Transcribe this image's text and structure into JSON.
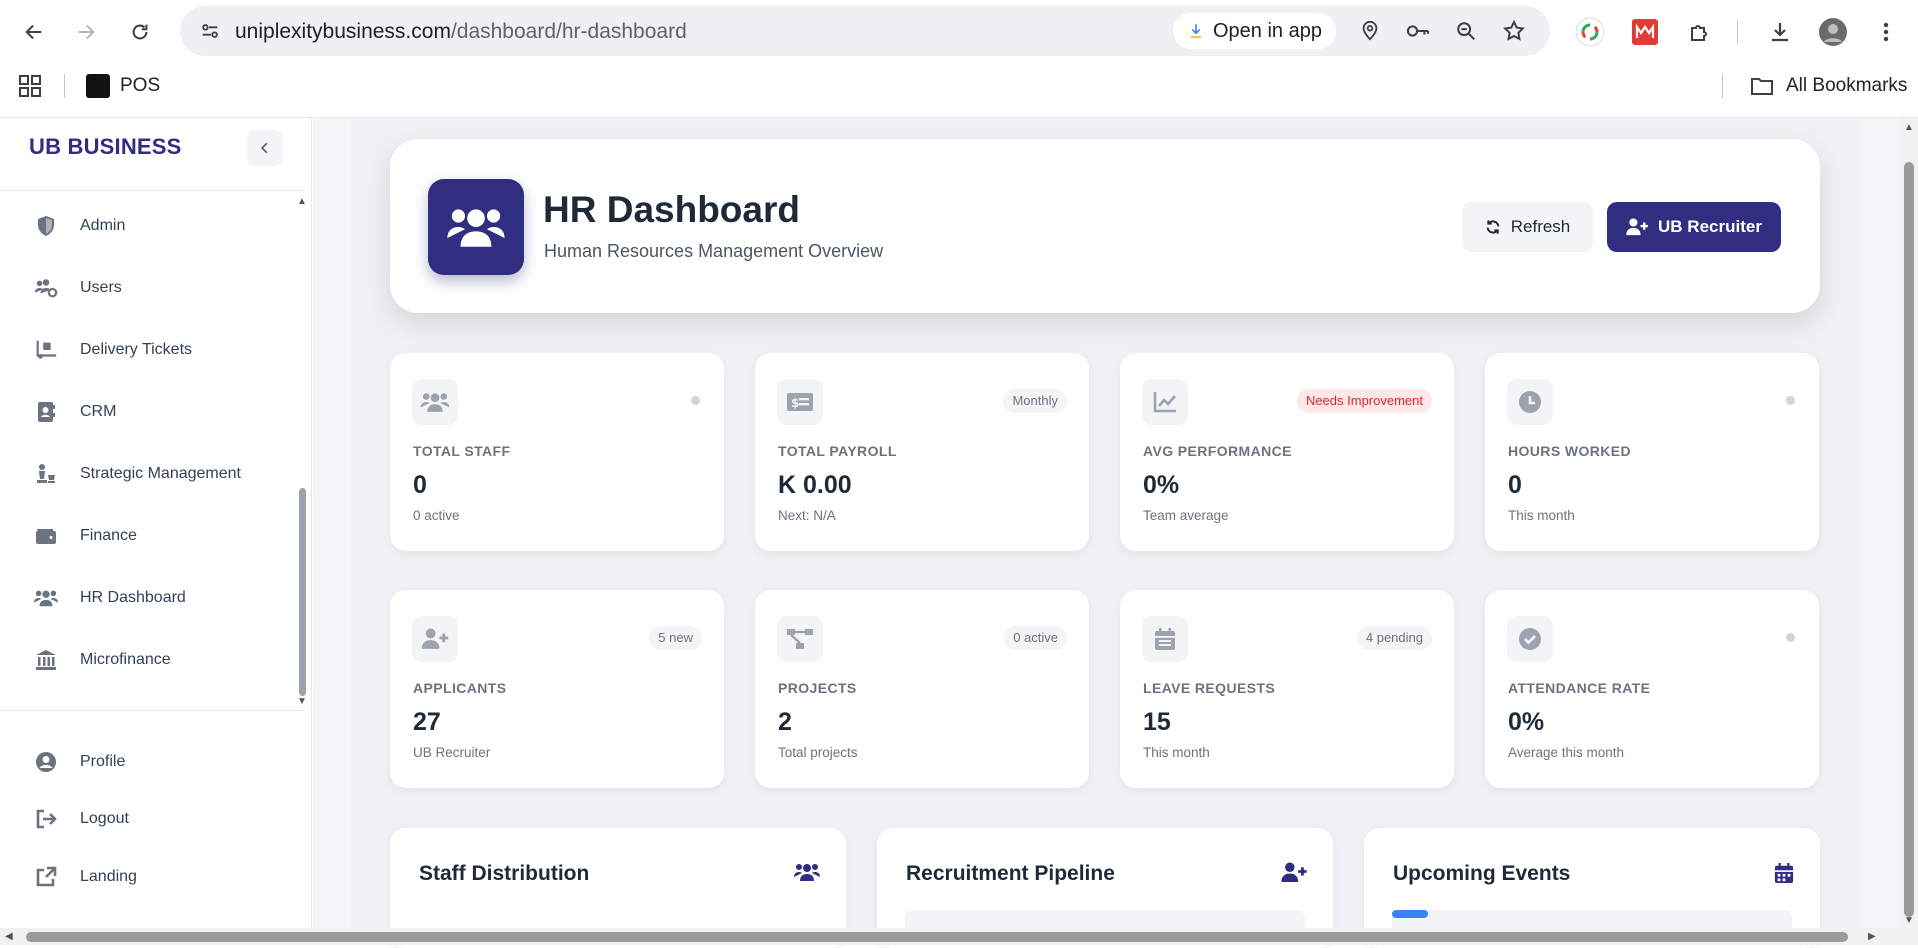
{
  "browser": {
    "url_host": "uniplexitybusiness.com",
    "url_path": "/dashboard/hr-dashboard",
    "open_in_app": "Open in app",
    "bookmarks": [
      {
        "label": "POS"
      }
    ],
    "all_bookmarks": "All Bookmarks"
  },
  "sidebar": {
    "brand": "UB BUSINESS",
    "items": [
      {
        "label": "Admin",
        "icon": "shield-icon"
      },
      {
        "label": "Users",
        "icon": "users-cog-icon"
      },
      {
        "label": "Delivery Tickets",
        "icon": "truck-loading-icon"
      },
      {
        "label": "CRM",
        "icon": "address-book-icon"
      },
      {
        "label": "Strategic Management",
        "icon": "chess-icon"
      },
      {
        "label": "Finance",
        "icon": "wallet-icon"
      },
      {
        "label": "HR Dashboard",
        "icon": "users-icon"
      },
      {
        "label": "Microfinance",
        "icon": "bank-icon"
      }
    ],
    "footer_items": [
      {
        "label": "Profile",
        "icon": "user-circle-icon"
      },
      {
        "label": "Logout",
        "icon": "logout-icon"
      },
      {
        "label": "Landing",
        "icon": "external-link-icon"
      }
    ]
  },
  "header": {
    "title": "HR Dashboard",
    "subtitle": "Human Resources Management Overview",
    "refresh_label": "Refresh",
    "recruiter_label": "UB Recruiter"
  },
  "stats": [
    {
      "label": "TOTAL STAFF",
      "value": "0",
      "sub": "0 active",
      "badge": "",
      "icon": "users-icon"
    },
    {
      "label": "TOTAL PAYROLL",
      "value": "K 0.00",
      "sub": "Next: N/A",
      "badge": "Monthly",
      "icon": "money-check-icon"
    },
    {
      "label": "AVG PERFORMANCE",
      "value": "0%",
      "sub": "Team average",
      "badge": "Needs Improvement",
      "icon": "chart-line-icon"
    },
    {
      "label": "HOURS WORKED",
      "value": "0",
      "sub": "This month",
      "badge": "",
      "icon": "clock-icon"
    },
    {
      "label": "APPLICANTS",
      "value": "27",
      "sub": "UB Recruiter",
      "badge": "5 new",
      "icon": "user-plus-icon"
    },
    {
      "label": "PROJECTS",
      "value": "2",
      "sub": "Total projects",
      "badge": "0 active",
      "icon": "project-diagram-icon"
    },
    {
      "label": "LEAVE REQUESTS",
      "value": "15",
      "sub": "This month",
      "badge": "4 pending",
      "icon": "calendar-icon"
    },
    {
      "label": "ATTENDANCE RATE",
      "value": "0%",
      "sub": "Average this month",
      "badge": "",
      "icon": "check-circle-icon"
    }
  ],
  "panels": [
    {
      "title": "Staff Distribution",
      "icon": "users-icon"
    },
    {
      "title": "Recruitment Pipeline",
      "icon": "user-plus-icon"
    },
    {
      "title": "Upcoming Events",
      "icon": "calendar-icon"
    }
  ],
  "colors": {
    "brand": "#312e81",
    "warning_badge_bg": "#fde8e8",
    "warning_badge_text": "#dc2626",
    "page_bg": "#f0f1f4"
  }
}
